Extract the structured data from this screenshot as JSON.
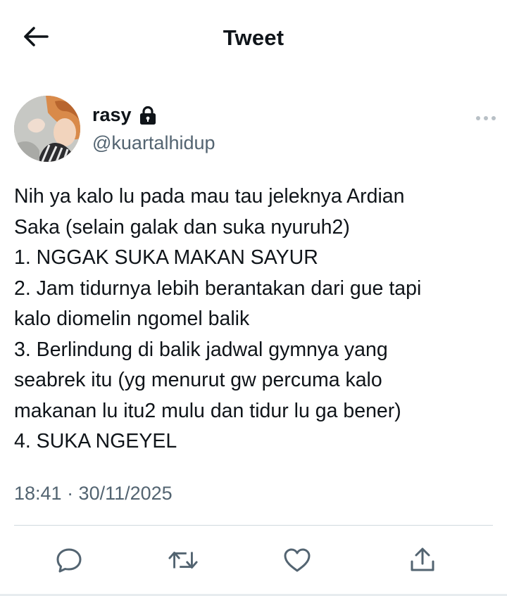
{
  "header": {
    "title": "Tweet"
  },
  "author": {
    "display_name": "rasy",
    "handle": "@kuartalhidup"
  },
  "tweet": {
    "lines": [
      "Nih ya kalo lu pada mau tau jeleknya Ardian",
      "Saka (selain galak dan suka nyuruh2)",
      "1. NGGAK SUKA MAKAN SAYUR",
      "2. Jam tidurnya lebih berantakan dari gue tapi",
      "kalo diomelin ngomel balik",
      "3. Berlindung di balik jadwal gymnya yang",
      "seabrek itu (yg menurut gw percuma kalo",
      "makanan lu itu2 mulu dan tidur lu ga bener)",
      "4. SUKA NGEYEL"
    ],
    "timestamp": "18:41 · 30/11/2025"
  },
  "icons": {
    "back": "arrow-left-icon",
    "lock": "lock-icon",
    "more": "more-icon",
    "reply": "reply-icon",
    "retweet": "retweet-icon",
    "like": "like-icon",
    "share": "share-icon"
  },
  "colors": {
    "text": "#0f1419",
    "secondary": "#536471",
    "divider": "#cfd9de"
  }
}
